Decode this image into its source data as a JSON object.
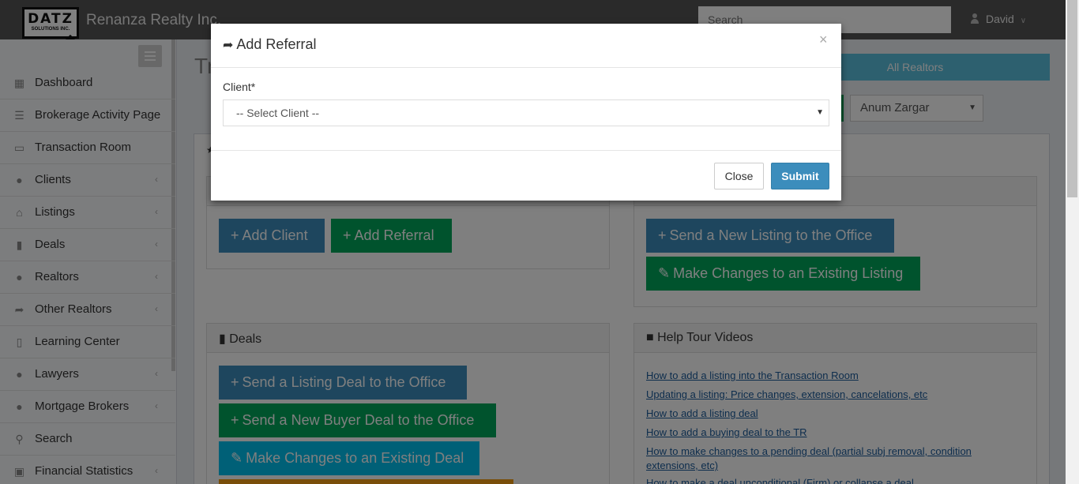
{
  "header": {
    "logo_main": "DATZ",
    "logo_sub": "SOLUTIONS INC.",
    "brand": "Renanza Realty Inc.",
    "search_placeholder": "Search",
    "user_name": "David"
  },
  "sidebar": {
    "items": [
      {
        "label": "Dashboard",
        "icon": "dashboard-icon",
        "arrow": false
      },
      {
        "label": "Brokerage Activity Page",
        "icon": "list-icon",
        "arrow": false
      },
      {
        "label": "Transaction Room",
        "icon": "inbox-icon",
        "arrow": false
      },
      {
        "label": "Clients",
        "icon": "user-icon",
        "arrow": true
      },
      {
        "label": "Listings",
        "icon": "home-icon",
        "arrow": true
      },
      {
        "label": "Deals",
        "icon": "file-icon",
        "arrow": true
      },
      {
        "label": "Realtors",
        "icon": "users-icon",
        "arrow": true
      },
      {
        "label": "Other Realtors",
        "icon": "share-icon",
        "arrow": true
      },
      {
        "label": "Learning Center",
        "icon": "book-icon",
        "arrow": false
      },
      {
        "label": "Lawyers",
        "icon": "users-icon",
        "arrow": true
      },
      {
        "label": "Mortgage Brokers",
        "icon": "users-icon",
        "arrow": true
      },
      {
        "label": "Search",
        "icon": "search-icon",
        "arrow": false
      },
      {
        "label": "Financial Statistics",
        "icon": "bank-icon",
        "arrow": true
      }
    ]
  },
  "main": {
    "title": "Tr",
    "all_realtors": "All Realtors",
    "realtor_selected": "Anum Zargar",
    "clients_buttons": {
      "add_client": "Add Client",
      "add_referral": "Add Referral"
    },
    "listings_buttons": {
      "send_new": "Send a New Listing to the Office",
      "make_changes": "Make Changes to an Existing Listing"
    },
    "deals": {
      "heading": "Deals",
      "send_listing_deal": "Send a Listing Deal to the Office",
      "send_buyer_deal": "Send a New Buyer Deal to the Office",
      "make_changes_deal": "Make Changes to an Existing Deal"
    },
    "videos": {
      "heading": "Help Tour Videos",
      "links": [
        "How to add a listing into the Transaction Room",
        "Updating a listing: Price changes, extension, cancelations, etc",
        "How to add a listing deal",
        "How to add a buying deal to the TR",
        "How to make changes to a pending deal (partial subj removal, condition extensions, etc)",
        "How to make a deal unconditional (Firm) or collapse a deal"
      ]
    }
  },
  "modal": {
    "title": "Add Referral",
    "close_x": "×",
    "client_label": "Client*",
    "client_selected": "-- Select Client --",
    "close_button": "Close",
    "submit_button": "Submit"
  }
}
